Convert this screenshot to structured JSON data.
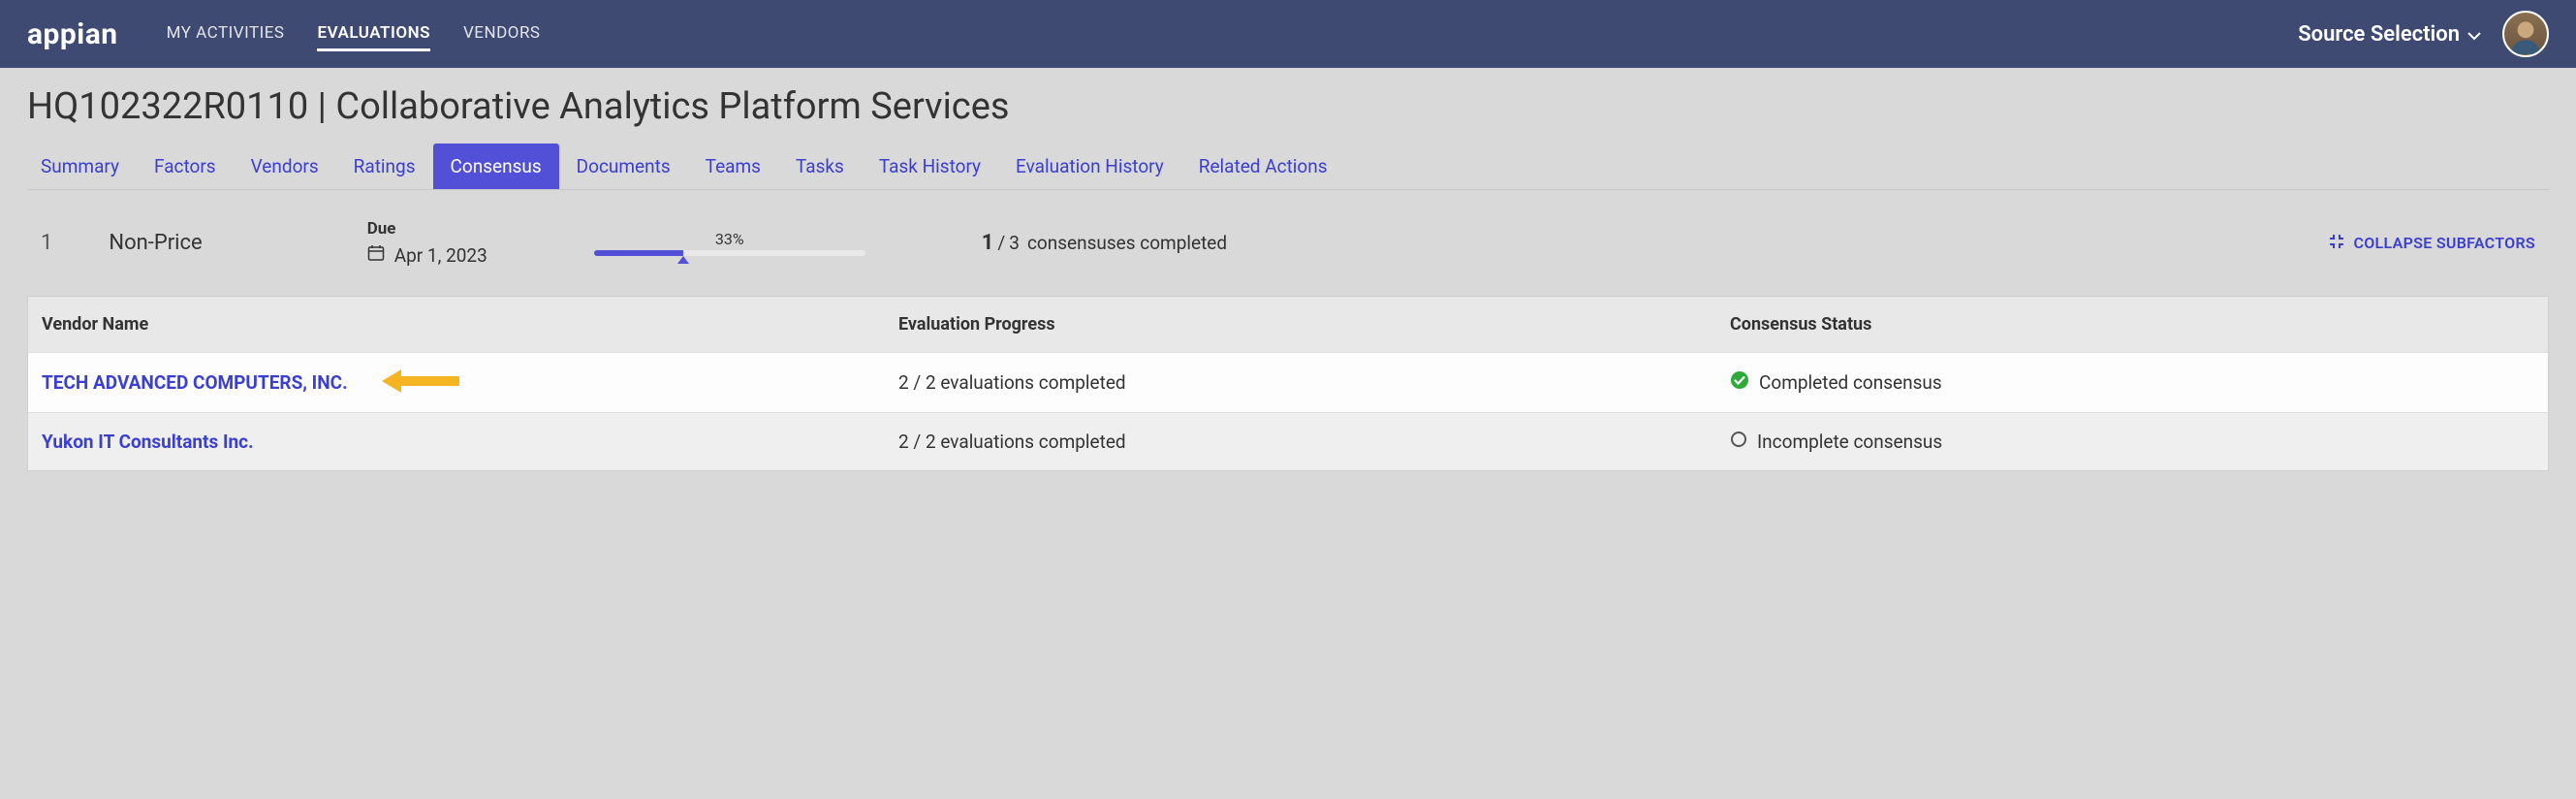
{
  "topnav": {
    "logo": "appian",
    "items": [
      "MY ACTIVITIES",
      "EVALUATIONS",
      "VENDORS"
    ],
    "active_index": 1,
    "source_selection": "Source Selection"
  },
  "page": {
    "title": "HQ102322R0110 | Collaborative Analytics Platform Services"
  },
  "subnav": {
    "items": [
      "Summary",
      "Factors",
      "Vendors",
      "Ratings",
      "Consensus",
      "Documents",
      "Teams",
      "Tasks",
      "Task History",
      "Evaluation History",
      "Related Actions"
    ],
    "active_index": 4
  },
  "summary": {
    "section_number": "1",
    "section_label": "Non-Price",
    "due_label": "Due",
    "due_date": "Apr 1, 2023",
    "progress_pct": 33,
    "progress_label": "33%",
    "consensus_done": "1",
    "consensus_total": "3",
    "consensus_suffix": "consensuses completed",
    "collapse_label": "COLLAPSE SUBFACTORS"
  },
  "table": {
    "headers": [
      "Vendor Name",
      "Evaluation Progress",
      "Consensus Status"
    ],
    "rows": [
      {
        "vendor": "TECH ADVANCED COMPUTERS, INC.",
        "progress": "2 / 2 evaluations completed",
        "status": "Completed consensus",
        "complete": true,
        "arrow": true
      },
      {
        "vendor": "Yukon IT Consultants Inc.",
        "progress": "2 / 2 evaluations completed",
        "status": "Incomplete consensus",
        "complete": false,
        "arrow": false
      }
    ]
  }
}
